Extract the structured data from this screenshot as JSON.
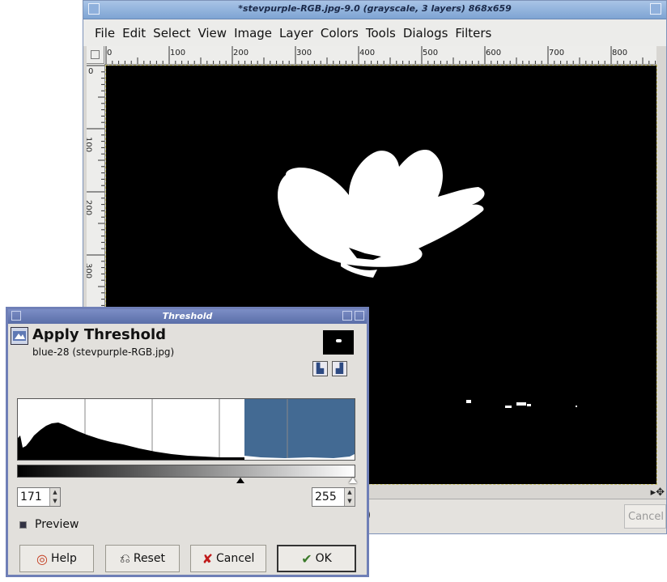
{
  "image_window": {
    "title": "*stevpurple-RGB.jpg-9.0 (grayscale, 3 layers) 868x659",
    "menu": [
      "File",
      "Edit",
      "Select",
      "View",
      "Image",
      "Layer",
      "Colors",
      "Tools",
      "Dialogs",
      "Filters"
    ],
    "ruler_h_labels": [
      "0",
      "100",
      "200",
      "300",
      "400",
      "500",
      "600",
      "700",
      "800"
    ],
    "ruler_v_labels": [
      "0",
      "100",
      "200",
      "300"
    ],
    "status_fragment": ")",
    "cancel_label": "Cancel"
  },
  "dialog": {
    "title": "Threshold",
    "heading": "Apply Threshold",
    "subtitle": "blue-28 (stevpurple-RGB.jpg)",
    "low_value": "171",
    "high_value": "255",
    "low_threshold": 171,
    "high_threshold": 255,
    "preview_label": "Preview",
    "preview_checked": true,
    "buttons": {
      "help": "Help",
      "reset": "Reset",
      "cancel": "Cancel",
      "ok": "OK"
    },
    "colors": {
      "selection": "#436a93",
      "titlebar": "#6f7fb7"
    }
  }
}
